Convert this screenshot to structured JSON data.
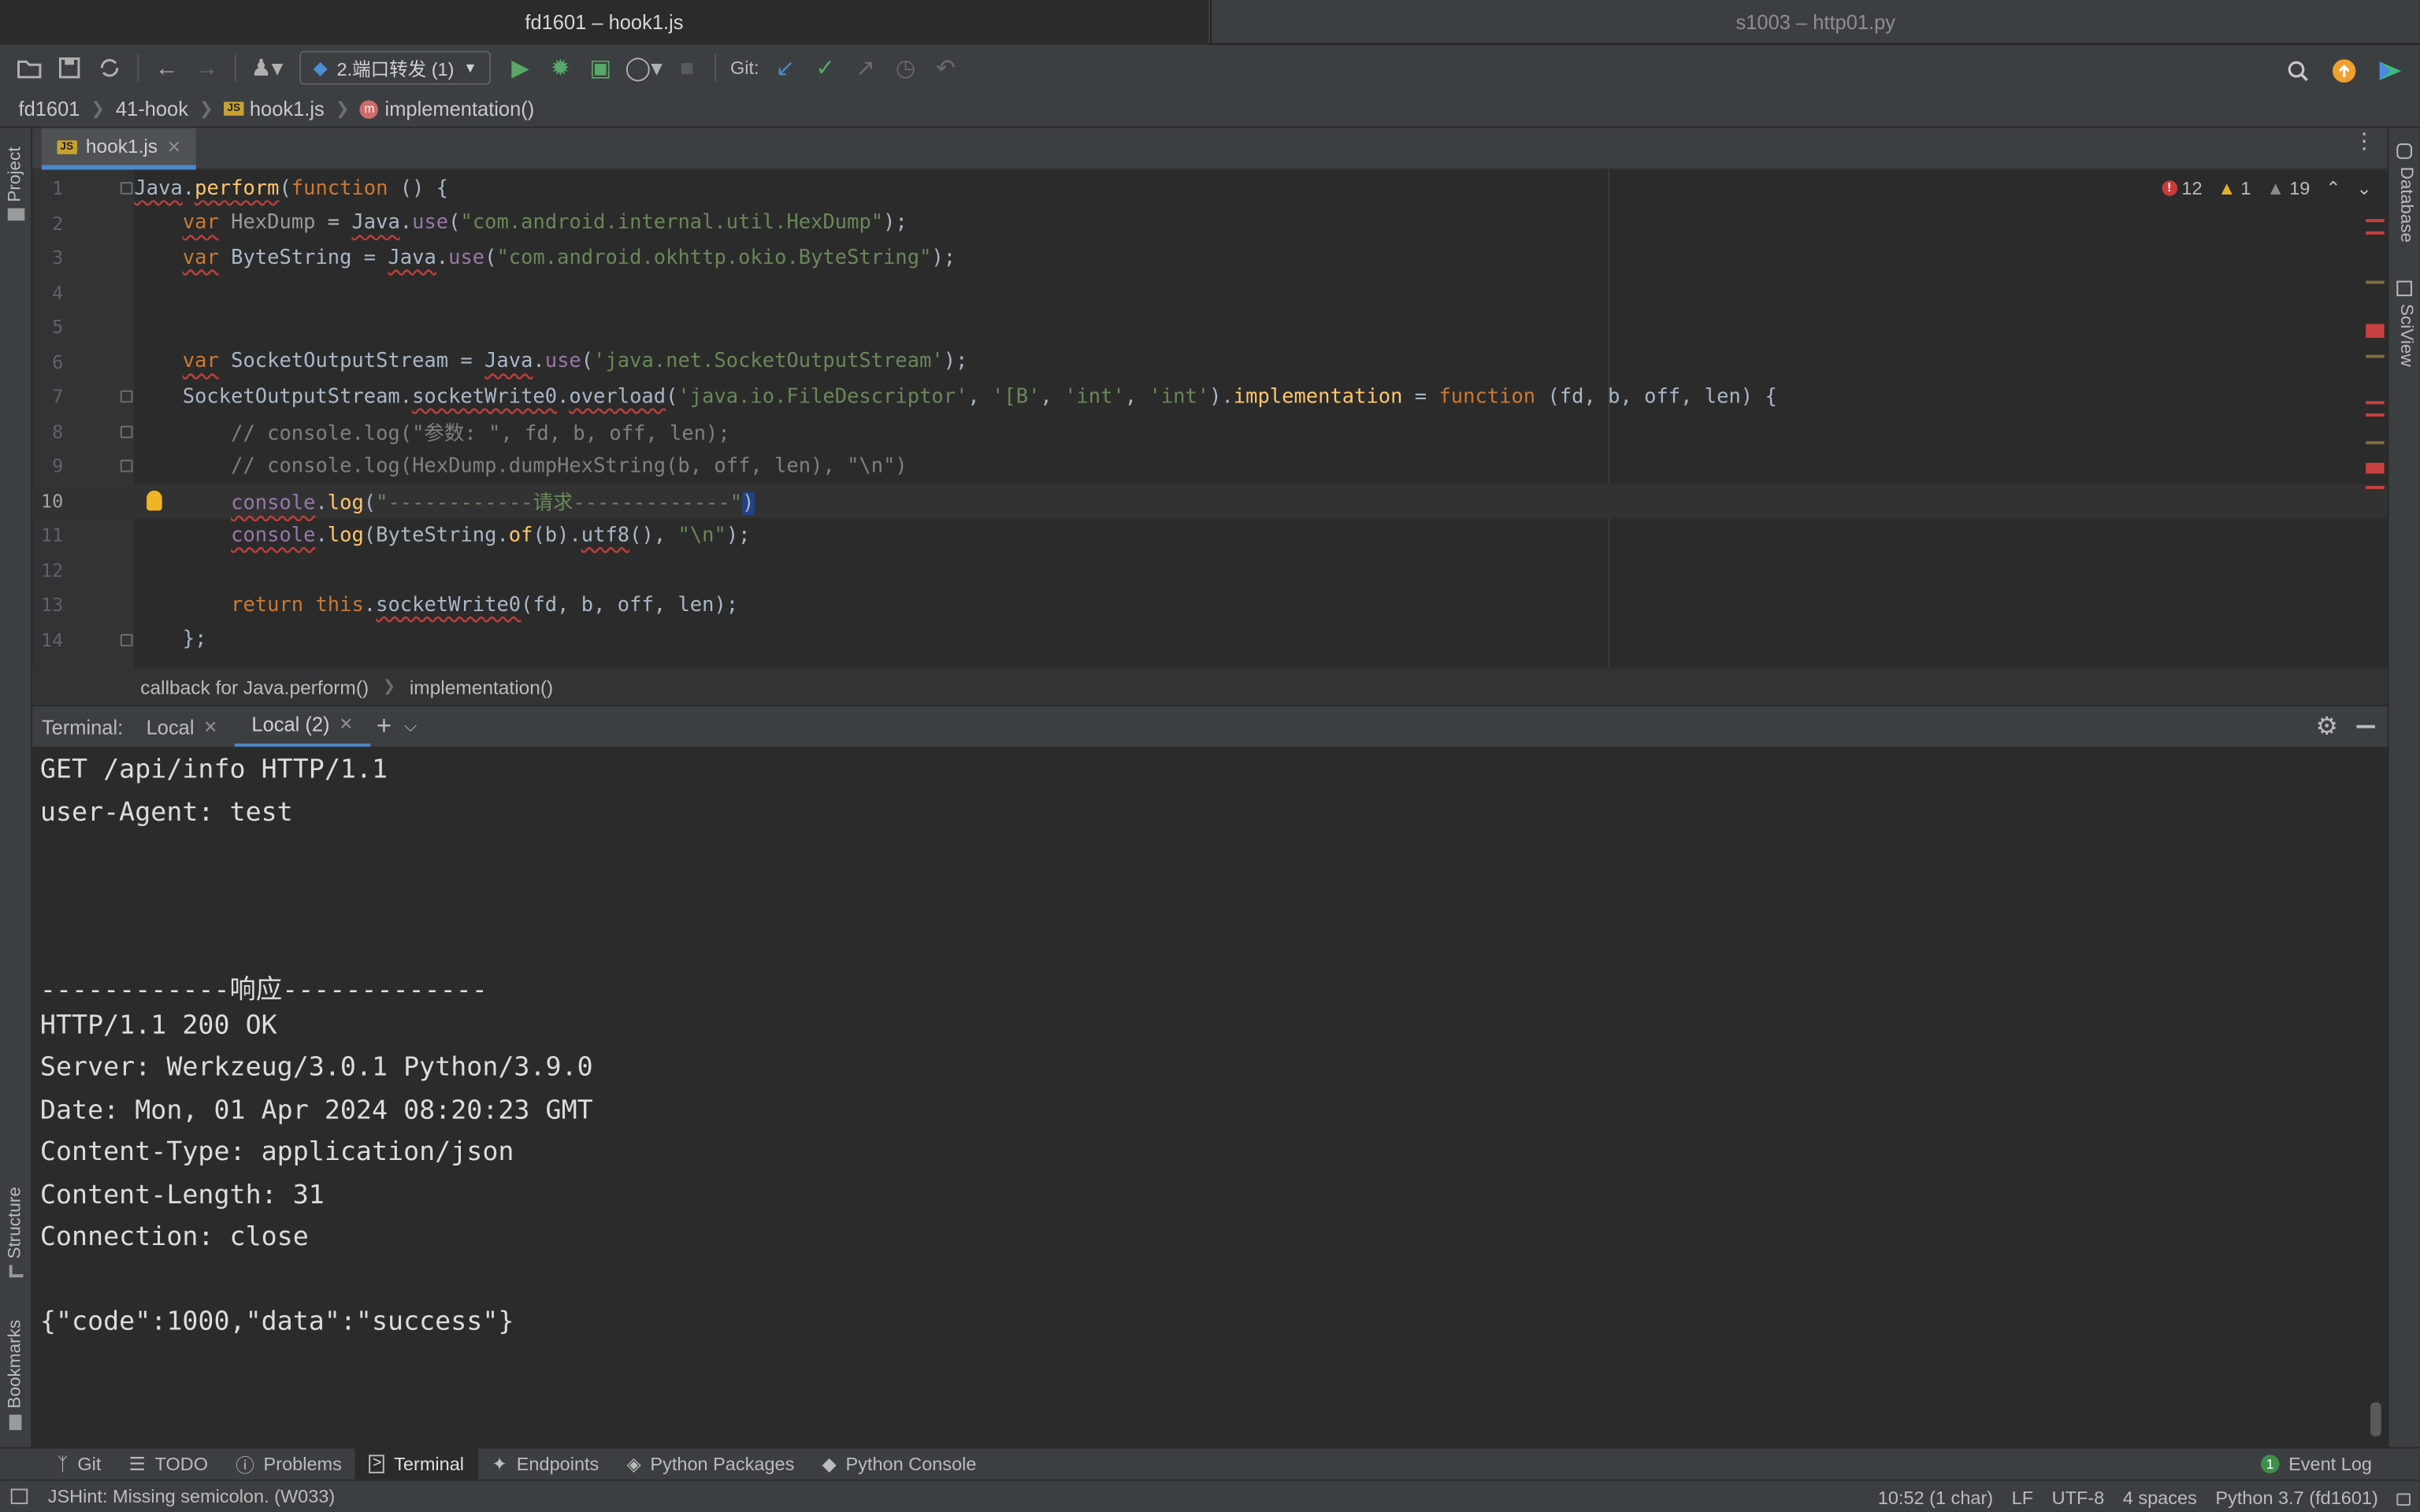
{
  "window": {
    "tabs": [
      {
        "label": "fd1601 – hook1.js"
      },
      {
        "label": "s1003 – http01.py"
      }
    ]
  },
  "toolbar": {
    "run_config": "2.端口转发 (1)",
    "git_label": "Git:"
  },
  "navbar": {
    "crumbs": [
      "fd1601",
      "41-hook",
      "hook1.js",
      "implementation()"
    ]
  },
  "sidebar_left": {
    "project": "Project",
    "structure": "Structure",
    "bookmarks": "Bookmarks"
  },
  "sidebar_right": {
    "database": "Database",
    "sciview": "SciView"
  },
  "editor": {
    "tab_label": "hook1.js",
    "inspections": {
      "errors": "12",
      "warnings": "1",
      "weak_warnings": "19"
    },
    "line_numbers": [
      "1",
      "2",
      "3",
      "4",
      "5",
      "6",
      "7",
      "8",
      "9",
      "10",
      "11",
      "12",
      "13",
      "14"
    ],
    "breadcrumb": [
      "callback for Java.perform()",
      "implementation()"
    ]
  },
  "terminal": {
    "label": "Terminal:",
    "tabs": [
      "Local",
      "Local (2)"
    ],
    "lines": [
      "GET /api/info HTTP/1.1",
      "user-Agent: test",
      "",
      "",
      "",
      "------------响应-------------",
      "HTTP/1.1 200 OK",
      "Server: Werkzeug/3.0.1 Python/3.9.0",
      "Date: Mon, 01 Apr 2024 08:20:23 GMT",
      "Content-Type: application/json",
      "Content-Length: 31",
      "Connection: close",
      "",
      "{\"code\":1000,\"data\":\"success\"}"
    ]
  },
  "bottom_tools": [
    "Git",
    "TODO",
    "Problems",
    "Terminal",
    "Endpoints",
    "Python Packages",
    "Python Console"
  ],
  "event_log": {
    "label": "Event Log",
    "count": "1"
  },
  "status": {
    "message": "JSHint: Missing semicolon. (W033)",
    "position": "10:52 (1 char)",
    "line_sep": "LF",
    "encoding": "UTF-8",
    "indent": "4 spaces",
    "interpreter": "Python 3.7 (fd1601)"
  }
}
